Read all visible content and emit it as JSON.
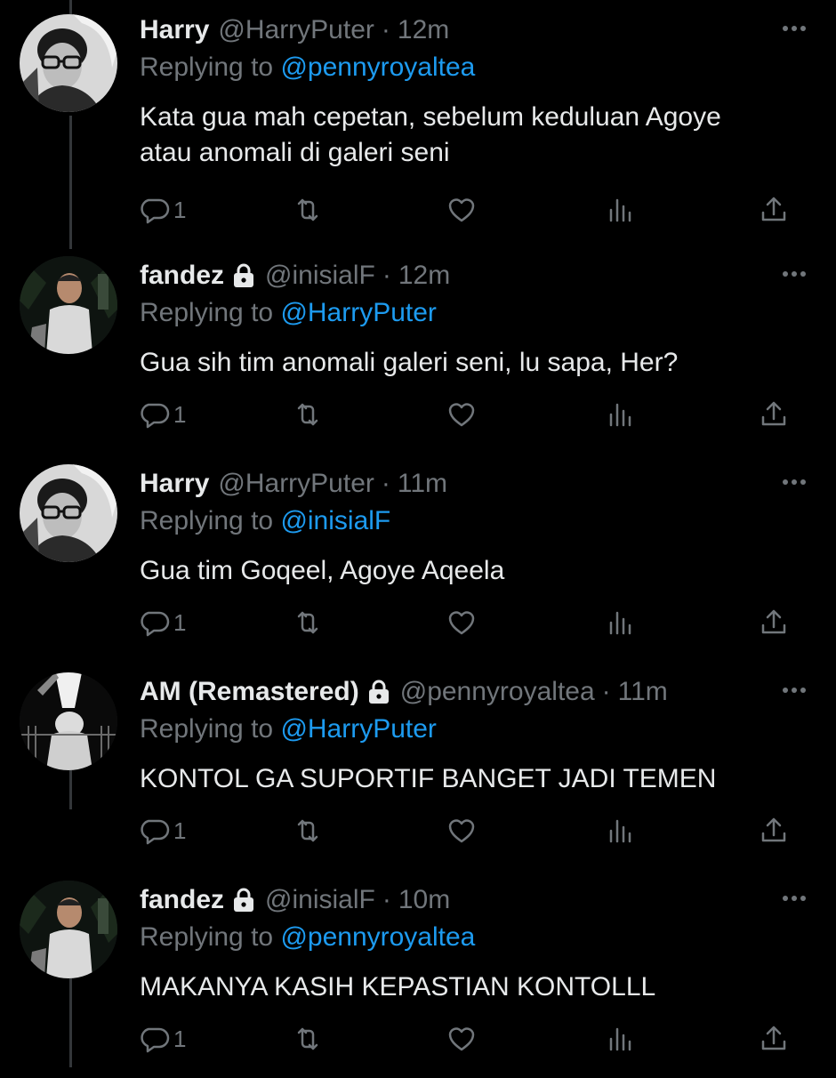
{
  "colors": {
    "background": "#000000",
    "text": "#e7e9ea",
    "muted": "#71767b",
    "link": "#1d9bf0"
  },
  "icons": {
    "reply": "reply-icon",
    "retweet": "retweet-icon",
    "like": "heart-icon",
    "views": "views-icon",
    "share": "share-icon",
    "more": "more-icon",
    "protected": "lock-icon"
  },
  "tweets": [
    {
      "name": "Harry",
      "protected": false,
      "handle": "@HarryPuter",
      "sep": "·",
      "time": "12m",
      "reply_prefix": "Replying to ",
      "reply_to": "@pennyroyaltea",
      "text": "Kata gua mah cepetan, sebelum keduluan Agoye\natau anomali di galeri seni",
      "reply_count": "1"
    },
    {
      "name": "fandez",
      "protected": true,
      "handle": "@inisialF",
      "sep": "·",
      "time": "12m",
      "reply_prefix": "Replying to ",
      "reply_to": "@HarryPuter",
      "text": "Gua sih tim anomali galeri seni, lu sapa, Her?",
      "reply_count": "1"
    },
    {
      "name": "Harry",
      "protected": false,
      "handle": "@HarryPuter",
      "sep": "·",
      "time": "11m",
      "reply_prefix": "Replying to ",
      "reply_to": "@inisialF",
      "text": "Gua tim Goqeel, Agoye Aqeela",
      "reply_count": "1"
    },
    {
      "name": "AM (Remastered)",
      "protected": true,
      "handle": "@pennyroyaltea",
      "sep": "·",
      "time": "11m",
      "reply_prefix": "Replying to ",
      "reply_to": "@HarryPuter",
      "text": "KONTOL GA SUPORTIF BANGET JADI TEMEN",
      "reply_count": "1"
    },
    {
      "name": "fandez",
      "protected": true,
      "handle": "@inisialF",
      "sep": "·",
      "time": "10m",
      "reply_prefix": "Replying to ",
      "reply_to": "@pennyroyaltea",
      "text": "MAKANYA KASIH KEPASTIAN KONTOLLL",
      "reply_count": "1"
    }
  ]
}
